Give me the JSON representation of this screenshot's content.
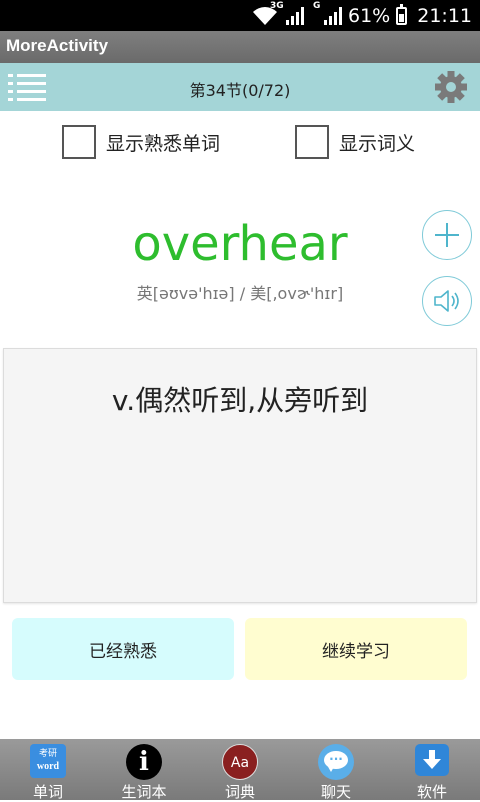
{
  "status_bar": {
    "network_label_1": "3G",
    "network_label_2": "G",
    "battery_text": "61%",
    "time": "21:11"
  },
  "app": {
    "title": "MoreActivity"
  },
  "header": {
    "title": "第34节(0/72)",
    "menu_icon": "menu-icon",
    "settings_icon": "gear-icon",
    "background_color": "#a4d5d7"
  },
  "options": {
    "show_familiar_label": "显示熟悉单词",
    "show_meaning_label": "显示词义"
  },
  "word": {
    "text": "overhear",
    "phonetic": "英[əʊvə'hɪə]  /  美[,ovɚ'hɪr]",
    "color": "#2ebd2e"
  },
  "side_buttons": {
    "add_icon": "plus-icon",
    "audio_icon": "speaker-icon"
  },
  "meaning": {
    "text": "v.偶然听到,从旁听到"
  },
  "actions": {
    "familiar_label": "已经熟悉",
    "familiar_color": "#d6fcfd",
    "continue_label": "继续学习",
    "continue_color": "#fffdd0"
  },
  "tabbar": {
    "tabs": [
      {
        "label": "单词",
        "icon": "word-app-icon",
        "icon_text_top": "考研",
        "icon_text_bottom": "word"
      },
      {
        "label": "生词本",
        "icon": "info-icon",
        "icon_text": "i"
      },
      {
        "label": "词典",
        "icon": "dictionary-icon",
        "icon_text": "Aa"
      },
      {
        "label": "聊天",
        "icon": "chat-icon",
        "icon_text": "···"
      },
      {
        "label": "软件",
        "icon": "download-icon"
      }
    ]
  }
}
